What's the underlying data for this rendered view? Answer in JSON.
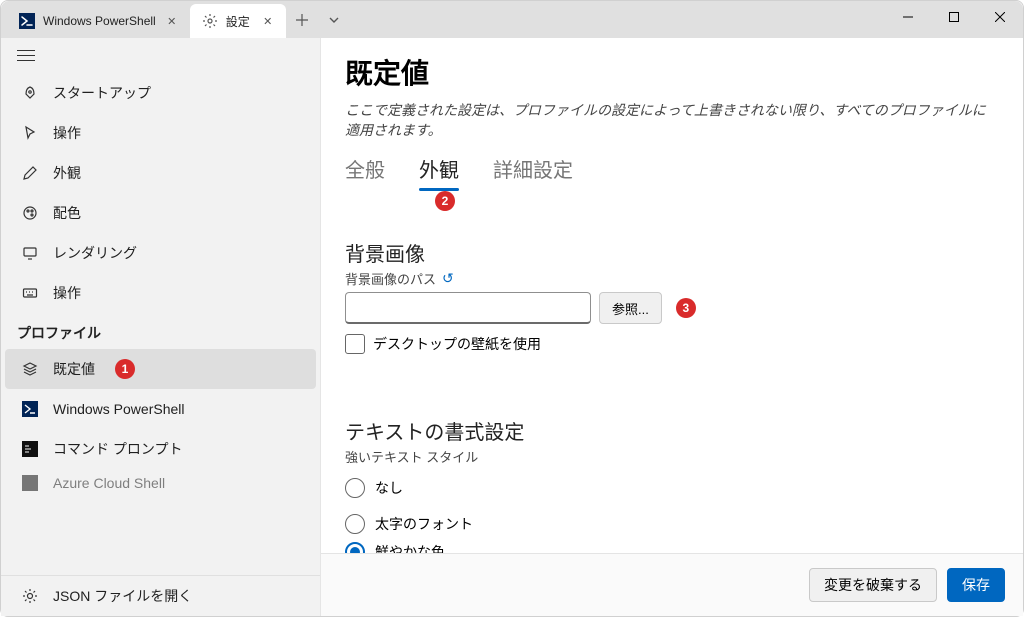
{
  "titlebar": {
    "tabs": [
      {
        "label": "Windows PowerShell",
        "active": false,
        "icon_bg": "#012456",
        "icon_fg": "#ffffff"
      },
      {
        "label": "設定",
        "active": true
      }
    ],
    "add_label": "+",
    "chevron_label": "˅"
  },
  "sidebar": {
    "items": [
      {
        "label": "スタートアップ",
        "icon": "rocket"
      },
      {
        "label": "操作",
        "icon": "cursor"
      },
      {
        "label": "外観",
        "icon": "pencil"
      },
      {
        "label": "配色",
        "icon": "palette"
      },
      {
        "label": "レンダリング",
        "icon": "monitor"
      },
      {
        "label": "操作",
        "icon": "keyboard"
      }
    ],
    "profiles_header": "プロファイル",
    "profile_items": [
      {
        "label": "既定値",
        "icon": "stack",
        "active": true,
        "badge": "1"
      },
      {
        "label": "Windows PowerShell",
        "icon": "ps"
      },
      {
        "label": "コマンド プロンプト",
        "icon": "cmd"
      },
      {
        "label": "Azure Cloud Shell",
        "icon": "azure",
        "partial": true
      }
    ],
    "footer_label": "JSON ファイルを開く"
  },
  "content": {
    "title": "既定値",
    "description": "ここで定義された設定は、プロファイルの設定によって上書きされない限り、すべてのプロファイルに適用されます。",
    "tabs": [
      {
        "label": "全般"
      },
      {
        "label": "外観",
        "active": true,
        "badge": "2"
      },
      {
        "label": "詳細設定"
      }
    ],
    "bg_section_title": "背景画像",
    "bg_field_label": "背景画像のパス",
    "bg_input_value": "",
    "browse_label": "参照...",
    "browse_badge": "3",
    "use_wallpaper_label": "デスクトップの壁紙を使用",
    "text_section_title": "テキストの書式設定",
    "text_field_label": "強いテキスト スタイル",
    "radio_options": [
      {
        "label": "なし",
        "selected": false
      },
      {
        "label": "太字のフォント",
        "selected": false
      },
      {
        "label": "鮮やかな色",
        "selected": true
      }
    ],
    "discard_label": "変更を破棄する",
    "save_label": "保存"
  }
}
